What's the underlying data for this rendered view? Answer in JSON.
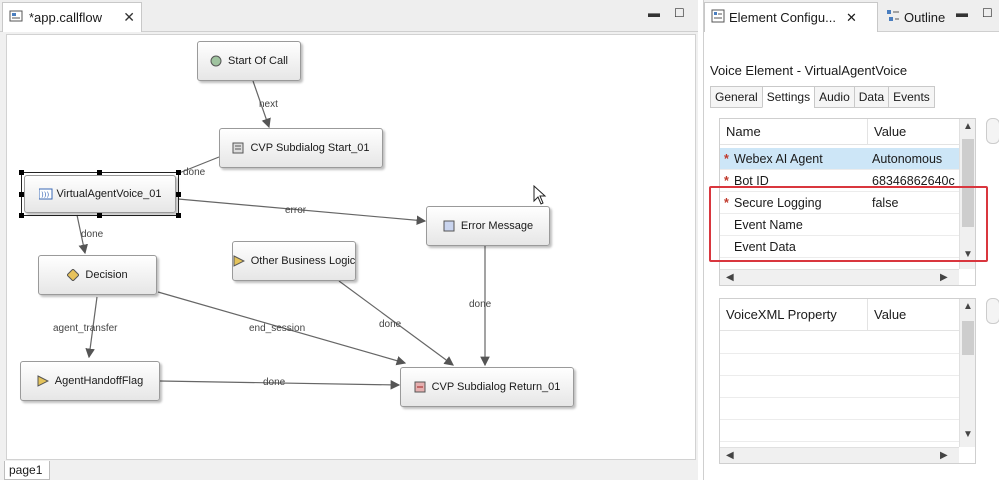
{
  "editor": {
    "tab_title": "*app.callflow",
    "page_tab": "page1",
    "nodes": {
      "start": "Start Of Call",
      "subdialog_start": "CVP Subdialog Start_01",
      "virtual_agent": "VirtualAgentVoice_01",
      "error_message": "Error Message",
      "decision": "Decision",
      "other_logic": "Other Business Logic",
      "handoff": "AgentHandoffFlag",
      "subdialog_return": "CVP Subdialog Return_01"
    },
    "edges": {
      "next": "next",
      "done_top": "done",
      "error": "error",
      "done_decision": "done",
      "agent_transfer": "agent_transfer",
      "end_session": "end_session",
      "done_other": "done",
      "done_error": "done",
      "done_handoff": "done"
    }
  },
  "panel": {
    "tabs": [
      "Element Configu...",
      "Outline"
    ],
    "element_title": "Voice Element - VirtualAgentVoice",
    "sub_tabs": [
      "General",
      "Settings",
      "Audio",
      "Data",
      "Events"
    ],
    "settings_table": {
      "headers": [
        "Name",
        "Value"
      ],
      "rows": [
        {
          "required": "*",
          "name": "Webex AI Agent",
          "value": "Autonomous"
        },
        {
          "required": "*",
          "name": "Bot ID",
          "value": "68346862640c"
        },
        {
          "required": "*",
          "name": "Secure Logging",
          "value": "false"
        },
        {
          "required": "",
          "name": "Event Name",
          "value": ""
        },
        {
          "required": "",
          "name": "Event Data",
          "value": ""
        }
      ]
    },
    "voicexml_table": {
      "headers": [
        "VoiceXML Property",
        "Value"
      ]
    }
  },
  "colors": {
    "selection_row": "#cde6f7",
    "highlight_box": "#d9363e",
    "required_marker": "#c0392b"
  },
  "icons": {
    "editor_tab": "callflow-file-icon",
    "close": "close-icon",
    "minimize": "minimize-icon",
    "maximize": "maximize-icon",
    "element_config": "settings-panel-icon",
    "outline": "outline-icon"
  }
}
